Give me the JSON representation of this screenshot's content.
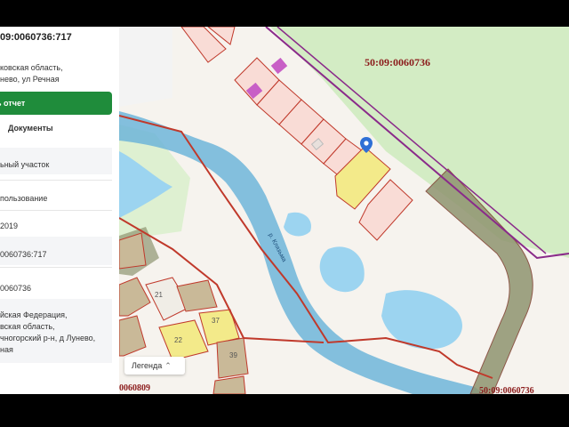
{
  "panel": {
    "cadastral_number": "09:0060736:717",
    "address_lines": [
      "ковская область,",
      "нево, ул Речная"
    ],
    "report_button": "ь отчет",
    "tab_documents": "Документы",
    "fields": [
      "ьный участок",
      "пользование",
      "2019",
      "0060736:717",
      "0060736",
      "йская Федерация,",
      "вская область,",
      "чногорский р-н, д Лунево,",
      "ная"
    ],
    "accent_color": "#1f8c3b"
  },
  "map": {
    "quarter_label": "50:09:0060736",
    "river_label": "р. Клязьма",
    "parcel_numbers": [
      "21",
      "22",
      "37",
      "39"
    ],
    "legend_label": "Легенда",
    "legend_icon": "chevron-up-icon",
    "bottom_left_label": "0060809",
    "bottom_right_label": "50:09:0060736",
    "pin_icon": "location-pin-icon",
    "colors": {
      "forest": "#d3ecc4",
      "water": "#9cd4f0",
      "river": "#6fb5d9",
      "boundary": "#c0392b",
      "parcel_fill": "#f9dcd6",
      "selected_parcel": "#f3ea8a",
      "building": "#c85fc6",
      "road_band": "#8f9470",
      "pin": "#2f6fd6"
    }
  }
}
